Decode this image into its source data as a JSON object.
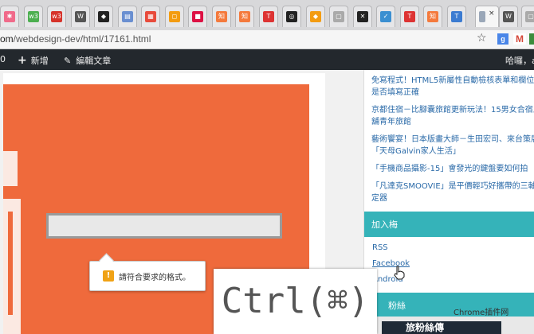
{
  "browser": {
    "tabs": [
      {
        "icon": "pinwheel-icon",
        "letter": "✱",
        "color": "#f06a8a"
      },
      {
        "icon": "w3-green-icon",
        "letter": "w3",
        "color": "#4caf50"
      },
      {
        "icon": "w3-red-icon",
        "letter": "w3",
        "color": "#d6332b"
      },
      {
        "icon": "wordpress-icon",
        "letter": "W",
        "color": "#555555"
      },
      {
        "icon": "space-invader-icon",
        "letter": "◆",
        "color": "#222222"
      },
      {
        "icon": "page-icon",
        "letter": "▤",
        "color": "#6a8fd1"
      },
      {
        "icon": "colorful-grid-icon",
        "letter": "▦",
        "color": "#e84b3c"
      },
      {
        "icon": "orange-square-icon",
        "letter": "◻",
        "color": "#f39c12"
      },
      {
        "icon": "red-label-icon",
        "letter": "■",
        "color": "#d14"
      },
      {
        "icon": "orange-badge-icon",
        "letter": "知",
        "color": "#f47a3d"
      },
      {
        "icon": "orange-badge-icon",
        "letter": "知",
        "color": "#f47a3d"
      },
      {
        "icon": "red-t-icon",
        "letter": "T",
        "color": "#d33"
      },
      {
        "icon": "dark-circle-icon",
        "letter": "◎",
        "color": "#222"
      },
      {
        "icon": "orange-diamond-icon",
        "letter": "◆",
        "color": "#f39c12"
      },
      {
        "icon": "document-icon",
        "letter": "▢",
        "color": "#aaaaaa"
      },
      {
        "icon": "x-icon",
        "letter": "✕",
        "color": "#222222"
      },
      {
        "icon": "check-icon",
        "letter": "✓",
        "color": "#3b8fd1"
      },
      {
        "icon": "red-t-icon",
        "letter": "T",
        "color": "#d33"
      },
      {
        "icon": "orange-badge-icon",
        "letter": "知",
        "color": "#f47a3d"
      },
      {
        "icon": "blue-t-icon",
        "letter": "T",
        "color": "#3b7bd1"
      }
    ],
    "active_tab_close": "×",
    "trailing_tabs": [
      {
        "icon": "wordpress-icon",
        "letter": "W",
        "color": "#555555"
      },
      {
        "icon": "document-icon",
        "letter": "▢",
        "color": "#aaaaaa"
      }
    ],
    "url_host": "om",
    "url_path": "/webdesign-dev/html/17161.html",
    "star": "☆",
    "ext_g": "g",
    "ext_m": "M"
  },
  "adminbar": {
    "lead": "0",
    "new_label": "新增",
    "edit_label": "編輯文章",
    "greeting": "哈囉，a"
  },
  "hero": {
    "tooltip_message": "請符合要求的格式。",
    "warning_symbol": "!"
  },
  "sidebar": {
    "posts": [
      "免寫程式！HTML5新屬性自動檢核表單和欄位格",
      "是否填寫正確",
      "京都住宿－比腳囊旅館更新玩法！15男女合宿上下",
      "舖青年旅館",
      "藝術饗宴！日本版畫大師－生田宏司、來台策展",
      "「天母Galvin家人生活」",
      "「手機商品攝影-15」會發光的鍵盤要如何拍",
      "「凡達克SMOOVIE」是平價輕巧好攜帶的三軸穩",
      "定器"
    ],
    "join_title": "加入梅",
    "join_links": [
      "RSS",
      "Facebook",
      "Android"
    ],
    "fans_title": "粉絲",
    "bottom_text": "旅粉絲傳",
    "watermark": "Chrome插件网"
  },
  "overlay": {
    "key_label": "Ctrl(⌘)"
  }
}
